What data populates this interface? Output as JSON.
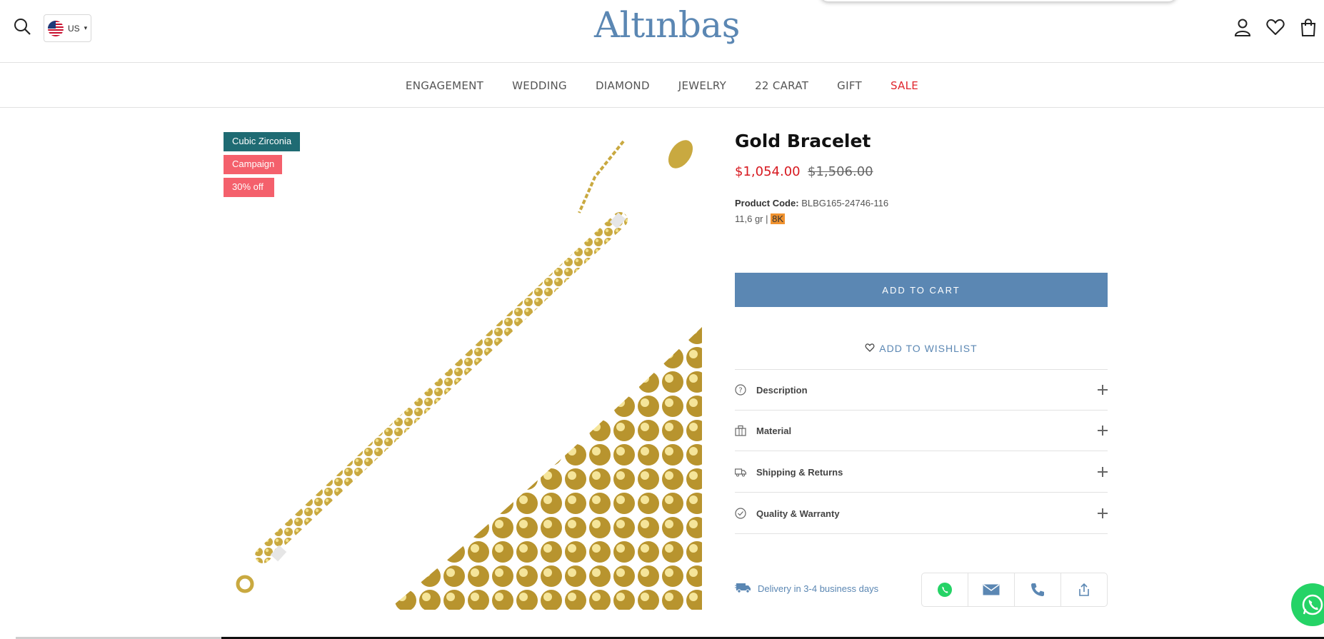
{
  "header": {
    "country_code": "US",
    "logo_text": "Altınbaş",
    "icons": [
      "search-icon",
      "account-icon",
      "heart-icon",
      "bag-icon"
    ]
  },
  "nav": {
    "items": [
      "ENGAGEMENT",
      "WEDDING",
      "DIAMOND",
      "JEWELRY",
      "22 CARAT",
      "GIFT",
      "SALE"
    ]
  },
  "badges": [
    {
      "label": "Cubic Zirconia",
      "color": "#1f6b73"
    },
    {
      "label": "Campaign",
      "color": "#f4606c"
    },
    {
      "label": "30% off",
      "color": "#f4606c"
    }
  ],
  "product": {
    "title": "Gold Bracelet",
    "price": "$1,054.00",
    "compare_price": "$1,506.00",
    "code_label": "Product Code:",
    "code_value": "BLBG165-24746-116",
    "weight": "11,6 gr |",
    "karat": "8K"
  },
  "actions": {
    "add_to_cart": "ADD TO CART",
    "add_to_wishlist": "ADD TO WISHLIST"
  },
  "accordion": [
    {
      "label": "Description",
      "icon": "question-icon"
    },
    {
      "label": "Material",
      "icon": "material-icon"
    },
    {
      "label": "Shipping & Returns",
      "icon": "truck-icon"
    },
    {
      "label": "Quality & Warranty",
      "icon": "check-circle-icon"
    }
  ],
  "delivery": {
    "text": "Delivery in 3-4 business days"
  },
  "share": [
    "whatsapp-icon",
    "mail-icon",
    "phone-icon",
    "share-icon"
  ],
  "colors": {
    "brand": "#5b87b3",
    "sale": "#e0262e",
    "price": "#d71920",
    "gold": "#c8a43a"
  }
}
